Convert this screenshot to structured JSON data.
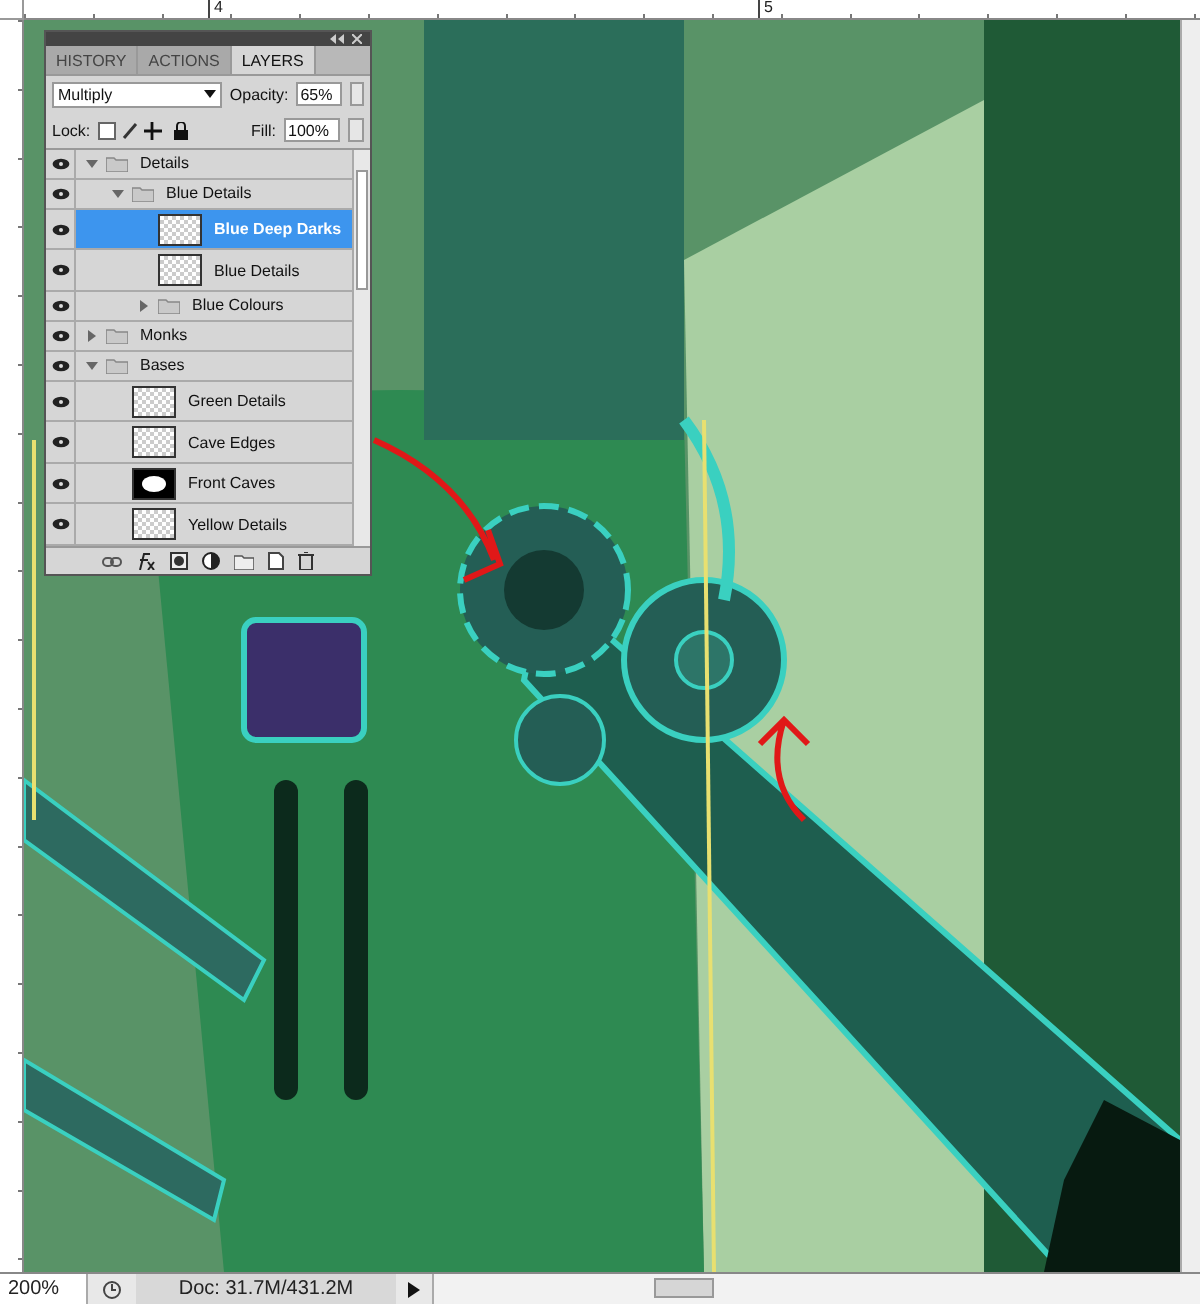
{
  "ruler": {
    "labels": [
      "4",
      "5"
    ]
  },
  "panel": {
    "tabs": [
      {
        "label": "HISTORY",
        "selected": false
      },
      {
        "label": "ACTIONS",
        "selected": false
      },
      {
        "label": "LAYERS",
        "selected": true
      }
    ],
    "blend_mode": "Multiply",
    "opacity_label": "Opacity:",
    "opacity": "65%",
    "lock_label": "Lock:",
    "fill_label": "Fill:",
    "fill": "100%",
    "layers": [
      {
        "kind": "group",
        "name": "Details",
        "selected": false,
        "expanded": true,
        "children": [
          {
            "kind": "group",
            "name": "Blue Details",
            "selected": false,
            "expanded": true,
            "children": [
              {
                "kind": "layer",
                "name": "Blue Deep Darks",
                "selected": true
              },
              {
                "kind": "layer",
                "name": "Blue Details",
                "selected": false
              },
              {
                "kind": "group",
                "name": "Blue Colours",
                "selected": false,
                "expanded": false
              }
            ]
          }
        ]
      },
      {
        "kind": "group",
        "name": "Monks",
        "selected": false,
        "expanded": false
      },
      {
        "kind": "group",
        "name": "Bases",
        "selected": false,
        "expanded": true,
        "children": [
          {
            "kind": "layer",
            "name": "Green Details",
            "selected": false
          },
          {
            "kind": "layer",
            "name": "Cave Edges",
            "selected": false
          },
          {
            "kind": "shapelayer",
            "name": "Front Caves",
            "selected": false
          },
          {
            "kind": "layer",
            "name": "Yellow Details",
            "selected": false
          }
        ]
      }
    ]
  },
  "status": {
    "zoom": "200%",
    "doc": "Doc: 31.7M/431.2M"
  }
}
